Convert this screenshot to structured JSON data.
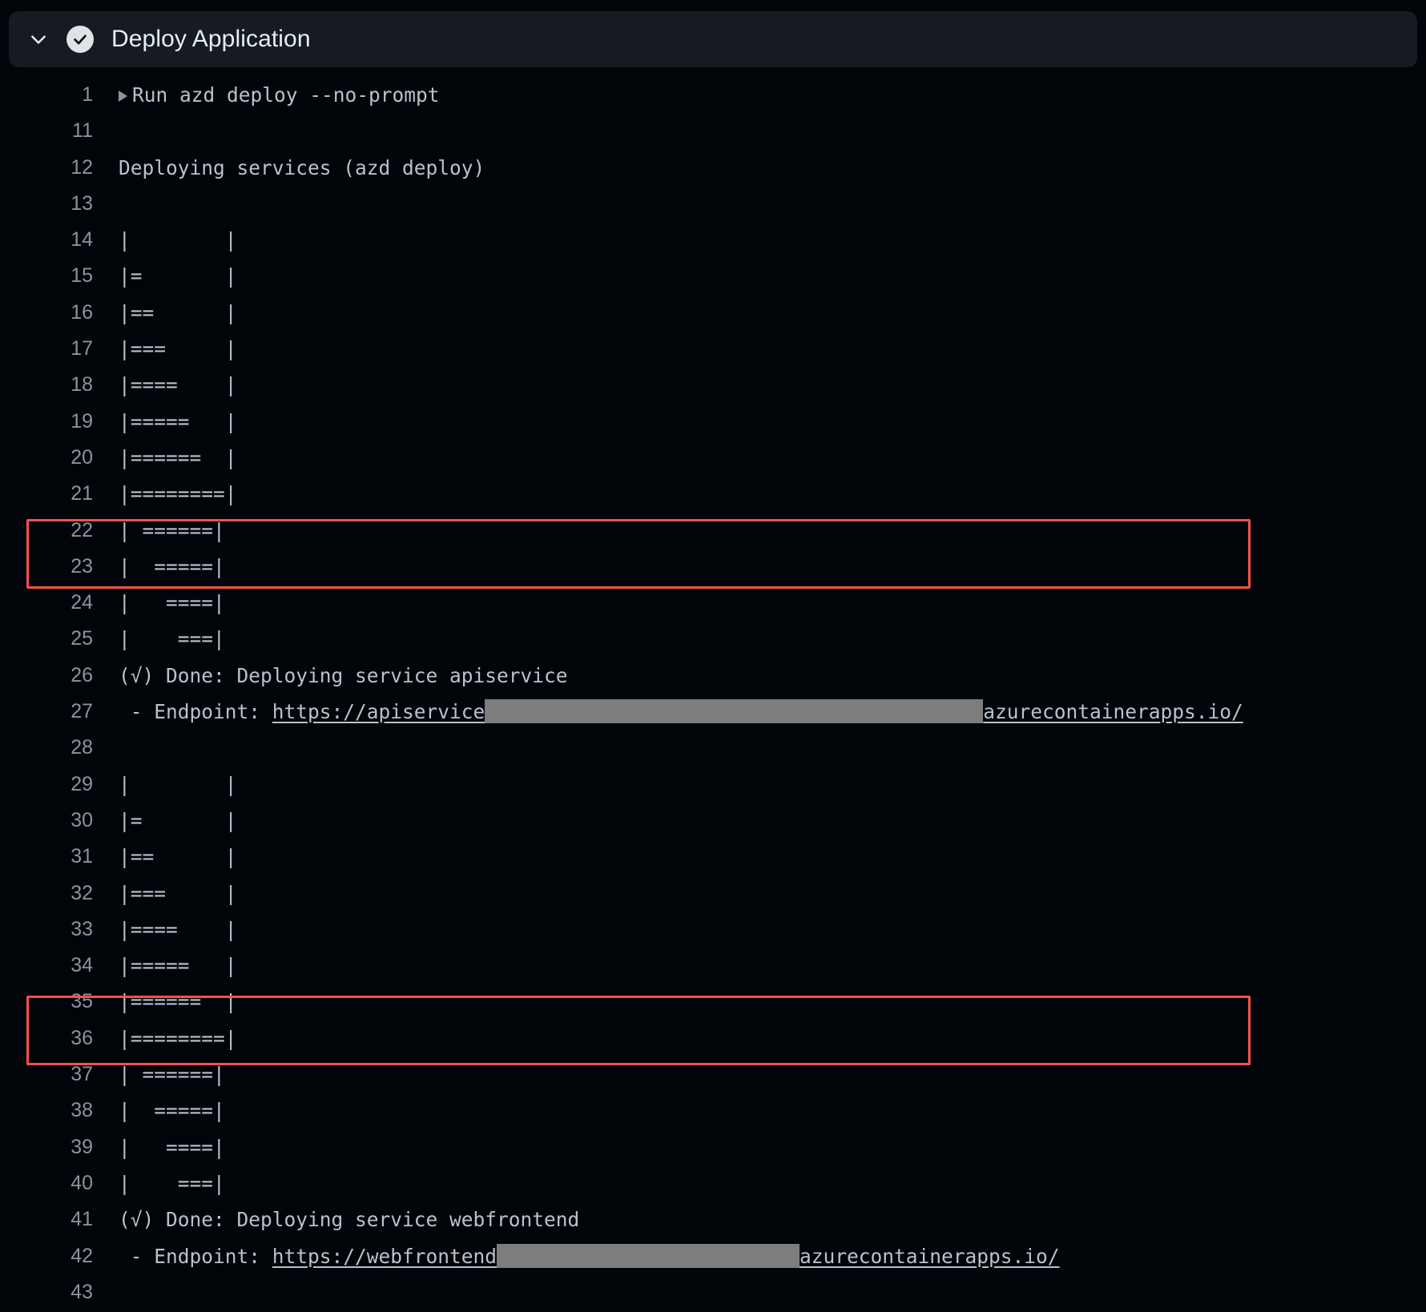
{
  "header": {
    "title": "Deploy Application",
    "chevron_icon": "chevron-down-icon",
    "status_icon": "check-circle-icon",
    "status": "success",
    "bg_color": "#161b22"
  },
  "theme": {
    "background": "#010409",
    "text": "#b9c2cc",
    "line_number": "#8b949e",
    "highlight_border": "#f85149",
    "redaction": "#7d7d7d"
  },
  "log": {
    "lines": [
      {
        "n": "1",
        "kind": "command",
        "text": "Run azd deploy --no-prompt"
      },
      {
        "n": "11",
        "kind": "blank",
        "text": ""
      },
      {
        "n": "12",
        "kind": "text",
        "text": "Deploying services (azd deploy)"
      },
      {
        "n": "13",
        "kind": "blank",
        "text": ""
      },
      {
        "n": "14",
        "kind": "text",
        "text": "|        |"
      },
      {
        "n": "15",
        "kind": "text",
        "text": "|=       |"
      },
      {
        "n": "16",
        "kind": "text",
        "text": "|==      |"
      },
      {
        "n": "17",
        "kind": "text",
        "text": "|===     |"
      },
      {
        "n": "18",
        "kind": "text",
        "text": "|====    |"
      },
      {
        "n": "19",
        "kind": "text",
        "text": "|=====   |"
      },
      {
        "n": "20",
        "kind": "text",
        "text": "|======  |"
      },
      {
        "n": "21",
        "kind": "text",
        "text": "|========|"
      },
      {
        "n": "22",
        "kind": "text",
        "text": "| ======|"
      },
      {
        "n": "23",
        "kind": "text",
        "text": "|  =====|"
      },
      {
        "n": "24",
        "kind": "text",
        "text": "|   ====|"
      },
      {
        "n": "25",
        "kind": "text",
        "text": "|    ===|"
      },
      {
        "n": "26",
        "kind": "done",
        "text": "(√) Done: Deploying service apiservice"
      },
      {
        "n": "27",
        "kind": "endpoint",
        "prefix": " - Endpoint: ",
        "url_head": "https://apiservice",
        "url_tail": "azurecontainerapps.io/",
        "redacted": true,
        "redact_size": "a"
      },
      {
        "n": "28",
        "kind": "blank",
        "text": ""
      },
      {
        "n": "29",
        "kind": "text",
        "text": "|        |"
      },
      {
        "n": "30",
        "kind": "text",
        "text": "|=       |"
      },
      {
        "n": "31",
        "kind": "text",
        "text": "|==      |"
      },
      {
        "n": "32",
        "kind": "text",
        "text": "|===     |"
      },
      {
        "n": "33",
        "kind": "text",
        "text": "|====    |"
      },
      {
        "n": "34",
        "kind": "text",
        "text": "|=====   |"
      },
      {
        "n": "35",
        "kind": "text",
        "text": "|======  |"
      },
      {
        "n": "36",
        "kind": "text",
        "text": "|========|"
      },
      {
        "n": "37",
        "kind": "text",
        "text": "| ======|"
      },
      {
        "n": "38",
        "kind": "text",
        "text": "|  =====|"
      },
      {
        "n": "39",
        "kind": "text",
        "text": "|   ====|"
      },
      {
        "n": "40",
        "kind": "text",
        "text": "|    ===|"
      },
      {
        "n": "41",
        "kind": "done",
        "text": "(√) Done: Deploying service webfrontend"
      },
      {
        "n": "42",
        "kind": "endpoint",
        "prefix": " - Endpoint: ",
        "url_head": "https://webfrontend",
        "url_tail": "azurecontainerapps.io/",
        "redacted": true,
        "redact_size": "b"
      },
      {
        "n": "43",
        "kind": "blank",
        "text": ""
      }
    ]
  },
  "highlights": [
    {
      "name": "apiservice-endpoint-highlight",
      "start_line": "26",
      "end_line": "27"
    },
    {
      "name": "webfrontend-endpoint-highlight",
      "start_line": "41",
      "end_line": "42"
    }
  ]
}
